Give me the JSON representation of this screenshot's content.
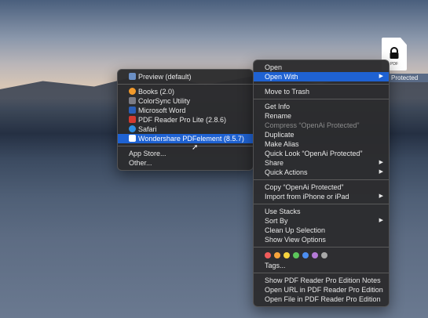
{
  "file": {
    "type_label": "PDF",
    "name": "Protected"
  },
  "submenu": {
    "default": "Preview (default)",
    "apps": [
      "Books (2.0)",
      "ColorSync Utility",
      "Microsoft Word",
      "PDF Reader Pro Lite (2.8.6)",
      "Safari",
      "Wondershare PDFelement (8.5.7)"
    ],
    "app_colors": [
      "#f39a2b",
      "#7c7c85",
      "#2b5fb8",
      "#d43a2f",
      "#2f8fe3",
      "#2a67d4"
    ],
    "app_store": "App Store...",
    "other": "Other..."
  },
  "menu": {
    "open": "Open",
    "open_with": "Open With",
    "move_to_trash": "Move to Trash",
    "get_info": "Get Info",
    "rename": "Rename",
    "compress": "Compress “OpenAi Protected”",
    "duplicate": "Duplicate",
    "make_alias": "Make Alias",
    "quick_look": "Quick Look “OpenAi Protected”",
    "share": "Share",
    "quick_actions": "Quick Actions",
    "copy": "Copy “OpenAi Protected”",
    "import": "Import from iPhone or iPad",
    "use_stacks": "Use Stacks",
    "sort_by": "Sort By",
    "clean_up": "Clean Up Selection",
    "show_view_options": "Show View Options",
    "tag_colors": [
      "#f05b5b",
      "#f6a33b",
      "#f5d33e",
      "#5cc65b",
      "#4c8ef0",
      "#b47ad6",
      "#a8a8a8"
    ],
    "tags": "Tags...",
    "show_notes": "Show PDF Reader Pro Edition Notes",
    "open_url": "Open URL in PDF Reader Pro Edition",
    "open_file": "Open File in PDF Reader Pro Edition"
  }
}
